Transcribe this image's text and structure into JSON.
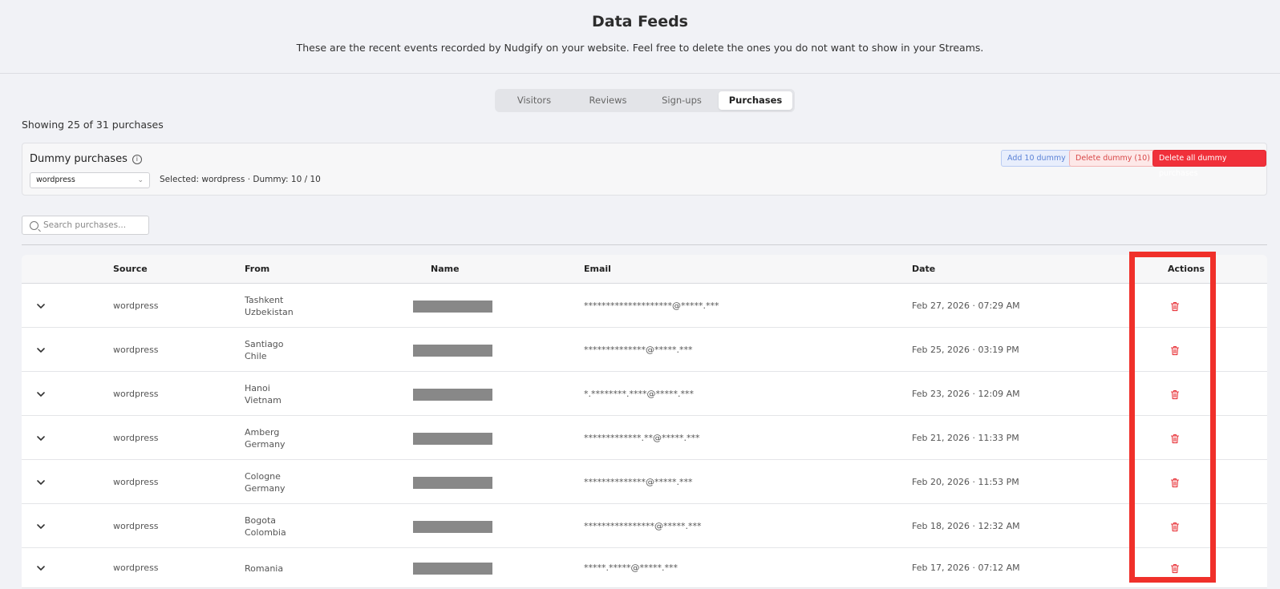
{
  "header": {
    "title": "Data Feeds",
    "subtitle": "These are the recent events recorded by Nudgify on your website. Feel free to delete the ones you do not want to show in your Streams."
  },
  "tabs": [
    "Visitors",
    "Reviews",
    "Sign-ups",
    "Purchases"
  ],
  "active_tab": "Purchases",
  "showing": "Showing 25 of 31 purchases",
  "dummy": {
    "title": "Dummy purchases",
    "info_icon": "info-icon",
    "select_value": "wordpress",
    "selected_info": "Selected: wordpress · Dummy: 10 / 10",
    "add_label": "Add 10 dummy",
    "delete_label": "Delete dummy (10)",
    "delete_all_label": "Delete all dummy purchases"
  },
  "search": {
    "placeholder": "Search purchases..."
  },
  "table": {
    "headers": {
      "source": "Source",
      "from": "From",
      "name": "Name",
      "email": "Email",
      "date": "Date",
      "actions": "Actions"
    },
    "rows": [
      {
        "source": "wordpress",
        "city": "Tashkent",
        "country": "Uzbekistan",
        "email": "********************@*****.***",
        "date": "Feb 27, 2026 · 07:29 AM"
      },
      {
        "source": "wordpress",
        "city": "Santiago",
        "country": "Chile",
        "email": "**************@*****.***",
        "date": "Feb 25, 2026 · 03:19 PM"
      },
      {
        "source": "wordpress",
        "city": "Hanoi",
        "country": "Vietnam",
        "email": "*.********.****@*****.***",
        "date": "Feb 23, 2026 · 12:09 AM"
      },
      {
        "source": "wordpress",
        "city": "Amberg",
        "country": "Germany",
        "email": "*************.**@*****.***",
        "date": "Feb 21, 2026 · 11:33 PM"
      },
      {
        "source": "wordpress",
        "city": "Cologne",
        "country": "Germany",
        "email": "**************@*****.***",
        "date": "Feb 20, 2026 · 11:53 PM"
      },
      {
        "source": "wordpress",
        "city": "Bogota",
        "country": "Colombia",
        "email": "****************@*****.***",
        "date": "Feb 18, 2026 · 12:32 AM"
      },
      {
        "source": "wordpress",
        "city": "Romania",
        "country": "",
        "email": "*****.*****@*****.***",
        "date": "Feb 17, 2026 · 07:12 AM"
      }
    ]
  },
  "colors": {
    "danger": "#f0303a",
    "highlight": "#f0302a",
    "add_blue": "#5b82d6"
  }
}
